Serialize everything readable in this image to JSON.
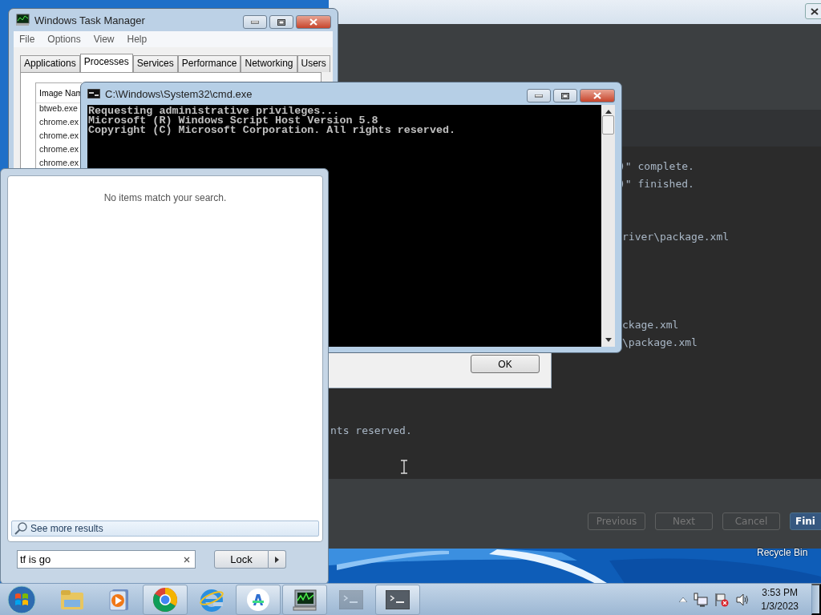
{
  "ide_window": {
    "console_lines": [
      ")\" complete.",
      ")\" finished.",
      "river\\package.xml",
      "ckage.xml",
      "\\package.xml",
      "nts reserved."
    ],
    "buttons": [
      {
        "label": "Previous",
        "kind": "disabled"
      },
      {
        "label": "Next",
        "kind": "disabled"
      },
      {
        "label": "Cancel",
        "kind": "disabled"
      },
      {
        "label": "Fini",
        "kind": "primary"
      }
    ]
  },
  "desktop": {
    "icon_labels": [
      "Recycle Bin"
    ]
  },
  "message_box": {
    "button": "OK"
  },
  "task_manager": {
    "title": "Windows Task Manager",
    "menu": [
      "File",
      "Options",
      "View",
      "Help"
    ],
    "tabs": [
      {
        "label": "Applications",
        "selected": false
      },
      {
        "label": "Processes",
        "selected": true
      },
      {
        "label": "Services",
        "selected": false
      },
      {
        "label": "Performance",
        "selected": false
      },
      {
        "label": "Networking",
        "selected": false
      },
      {
        "label": "Users",
        "selected": false
      }
    ],
    "column": "Image Nam",
    "rows": [
      "btweb.exe",
      "chrome.ex",
      "chrome.ex",
      "chrome.ex",
      "chrome.ex"
    ]
  },
  "cmd_window": {
    "title": "C:\\Windows\\System32\\cmd.exe",
    "lines": [
      "Requesting administrative privileges...",
      "Microsoft (R) Windows Script Host Version 5.8",
      "Copyright (C) Microsoft Corporation. All rights reserved."
    ]
  },
  "start_menu": {
    "message": "No items match your search.",
    "see_more": "See more results",
    "search": {
      "value": "tf is go"
    },
    "power_button": "Lock"
  },
  "taskbar": {
    "items": [
      {
        "kind": "explorer",
        "running": false,
        "faded": false
      },
      {
        "kind": "media",
        "running": false,
        "faded": false
      },
      {
        "kind": "chrome",
        "running": true,
        "faded": false
      },
      {
        "kind": "ie",
        "running": false,
        "faded": false
      },
      {
        "kind": "studio",
        "running": true,
        "faded": false
      },
      {
        "kind": "taskmgr",
        "running": true,
        "faded": false
      },
      {
        "kind": "console",
        "running": false,
        "faded": true
      },
      {
        "kind": "console",
        "running": true,
        "faded": false
      }
    ],
    "clock": {
      "time": "3:53 PM",
      "date": "1/3/2023"
    }
  }
}
